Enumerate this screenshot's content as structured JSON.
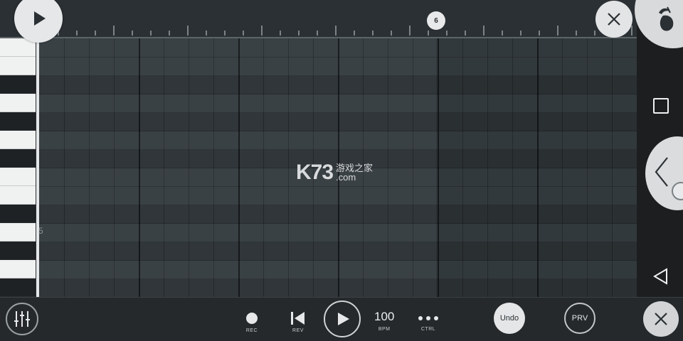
{
  "colors": {
    "background": "#2a2e31",
    "grid_light": "#3a4145",
    "grid_dark": "#30363a",
    "accent_light": "#e6e7e8"
  },
  "icons": {
    "top_play": "play-icon",
    "top_close": "close-icon",
    "logo": "fruity-logo-icon",
    "mixer": "mixer-sliders-icon",
    "rec": "record-dot-icon",
    "rev": "skip-back-icon",
    "play": "play-icon",
    "ctrl": "dots-icon",
    "close_bottom": "close-icon",
    "square": "square-icon",
    "chevron": "chevron-left-icon",
    "back": "back-triangle-icon"
  },
  "ruler": {
    "marker_label": "6"
  },
  "keyboard": {
    "octave_label": "5"
  },
  "watermark": {
    "brand": "K73",
    "cn": "游戏之家",
    "domain": ".com"
  },
  "toolbar": {
    "rec_label": "REC",
    "rev_label": "REV",
    "bpm_value": "100",
    "bpm_label": "BPM",
    "ctrl_label": "CTRL",
    "undo_label": "Undo",
    "prv_label": "PRV"
  }
}
